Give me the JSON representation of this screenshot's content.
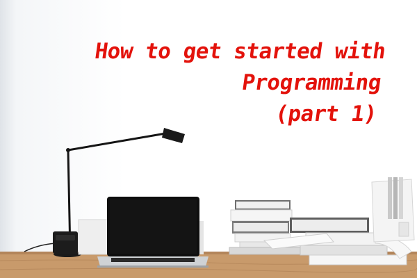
{
  "title": {
    "line1": "How to get started with",
    "line2": "Programming",
    "line3": "(part 1)"
  },
  "colors": {
    "title": "#e3120b",
    "desk": "#c89a6b",
    "wall": "#ffffff"
  }
}
